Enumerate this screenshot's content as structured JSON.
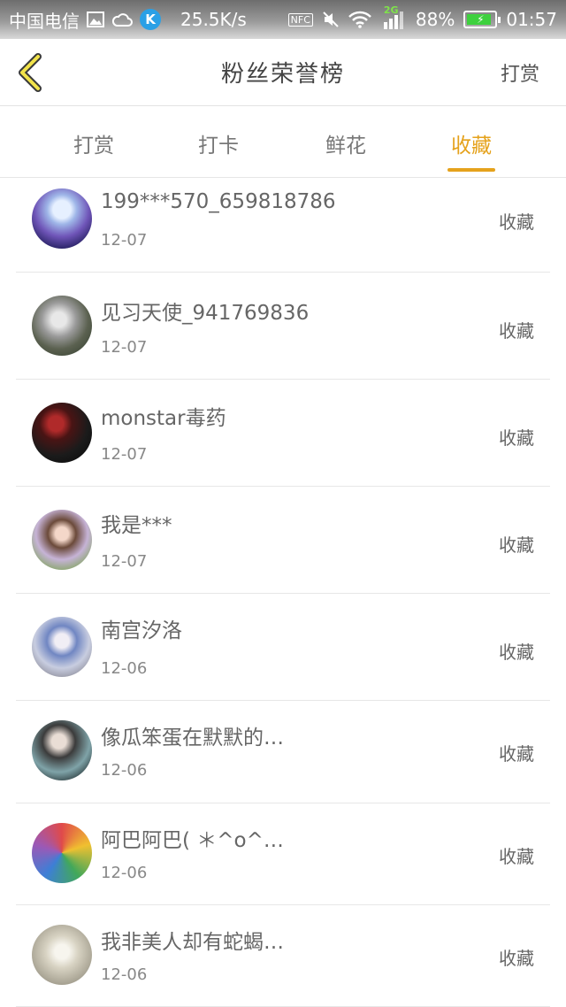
{
  "status_bar": {
    "carrier": "中国电信",
    "speed": "25.5K/s",
    "nfc": "NFC",
    "network": "2G",
    "battery": "88%",
    "battery_level": 0.88,
    "time": "01:57"
  },
  "header": {
    "title": "粉丝荣誉榜",
    "right_action": "打赏"
  },
  "tabs": [
    "打赏",
    "打卡",
    "鲜花",
    "收藏"
  ],
  "active_tab": "收藏",
  "accent_color": "#e5a21c",
  "list": [
    {
      "name": "199***570_659818786",
      "date": "12-07",
      "action": "收藏"
    },
    {
      "name": "见习天使_941769836",
      "date": "12-07",
      "action": "收藏"
    },
    {
      "name": "monstar毒药",
      "date": "12-07",
      "action": "收藏"
    },
    {
      "name": "我是***",
      "date": "12-07",
      "action": "收藏"
    },
    {
      "name": "南宫汐洛",
      "date": "12-06",
      "action": "收藏"
    },
    {
      "name": "像瓜笨蛋在默默的…",
      "date": "12-06",
      "action": "收藏"
    },
    {
      "name": "阿巴阿巴( ＊^o^…",
      "date": "12-06",
      "action": "收藏"
    },
    {
      "name": "我非美人却有蛇蝎…",
      "date": "12-06",
      "action": "收藏"
    }
  ]
}
